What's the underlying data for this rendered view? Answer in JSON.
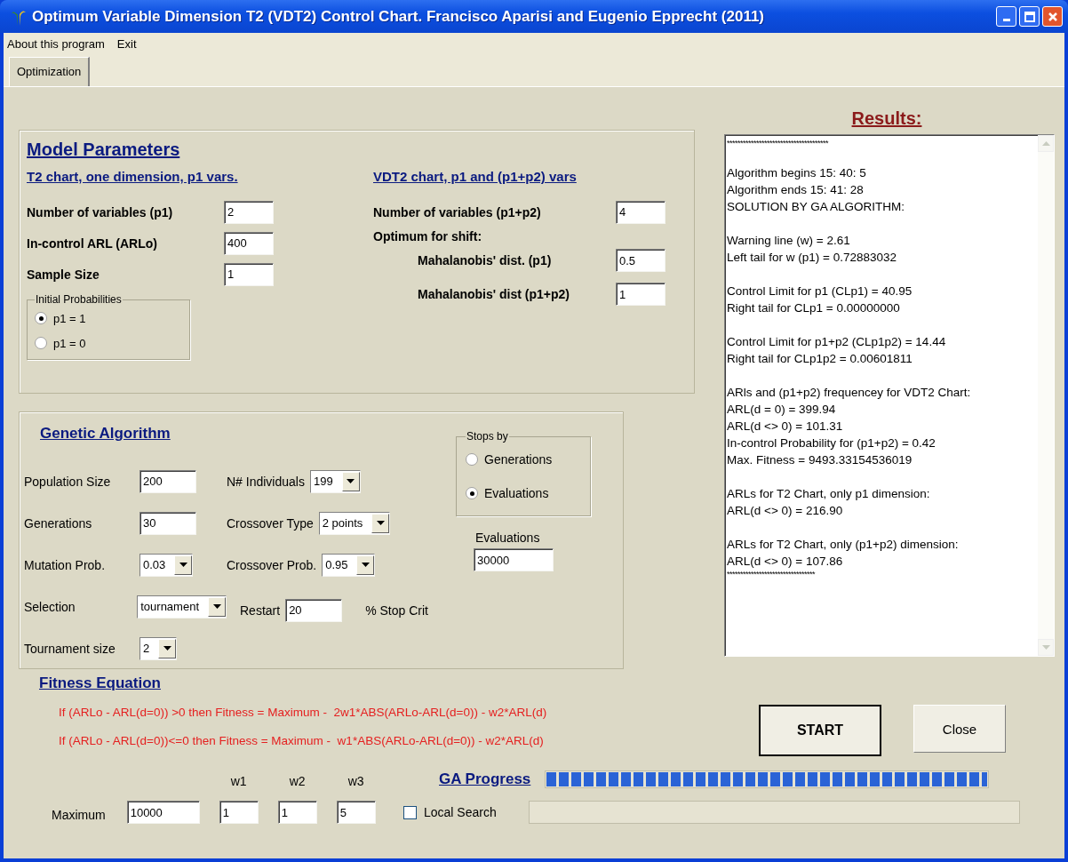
{
  "window": {
    "title": "Optimum Variable Dimension T2 (VDT2) Control Chart. Francisco Aparisi and Eugenio Epprecht (2011)"
  },
  "menu": [
    {
      "label": "About this program"
    },
    {
      "label": "Exit"
    }
  ],
  "tabs": [
    {
      "label": "Optimization",
      "selected": true
    }
  ],
  "model_parameters": {
    "title": "Model Parameters",
    "t2": {
      "heading": "T2 chart, one dimension, p1 vars.",
      "fields": [
        {
          "label": "Number of variables (p1)",
          "value": "2"
        },
        {
          "label": "In-control ARL (ARLo)",
          "value": "400"
        },
        {
          "label": "Sample Size",
          "value": "1"
        }
      ],
      "initial_probabilities": {
        "title": "Initial Probabilities",
        "options": [
          {
            "label": "p1 = 1",
            "selected": true
          },
          {
            "label": "p1 = 0",
            "selected": false
          }
        ]
      }
    },
    "vdt2": {
      "heading": "VDT2 chart, p1 and (p1+p2) vars",
      "fields": [
        {
          "label": "Number of variables (p1+p2)",
          "value": "4"
        }
      ],
      "shift_heading": "Optimum for shift:",
      "shift_fields": [
        {
          "label": "Mahalanobis' dist. (p1)",
          "value": "0.5"
        },
        {
          "label": "Mahalanobis' dist  (p1+p2)",
          "value": "1"
        }
      ]
    }
  },
  "genetic_algorithm": {
    "title": "Genetic Algorithm",
    "column_1": [
      {
        "label": "Population Size",
        "value": "200",
        "kind": "input"
      },
      {
        "label": "Generations",
        "value": "30",
        "kind": "input"
      },
      {
        "label": "Mutation Prob.",
        "value": "0.03",
        "kind": "dropdown"
      },
      {
        "label": "Selection",
        "value": "tournament",
        "kind": "dropdown"
      },
      {
        "label": "Tournament size",
        "value": "2",
        "kind": "dropdown"
      }
    ],
    "column_2": [
      {
        "label": "N# Individuals",
        "value": "199",
        "kind": "dropdown"
      },
      {
        "label": "Crossover Type",
        "value": "2 points",
        "kind": "dropdown"
      },
      {
        "label": "Crossover Prob.",
        "value": "0.95",
        "kind": "dropdown"
      },
      {
        "label": "Restart",
        "value": "20",
        "kind": "input",
        "suffix": "% Stop Crit"
      }
    ],
    "stops_by": {
      "title": "Stops by",
      "options": [
        {
          "label": "Generations",
          "selected": false
        },
        {
          "label": "Evaluations",
          "selected": true
        }
      ]
    },
    "evaluations": {
      "label": "Evaluations",
      "value": "30000"
    }
  },
  "results": {
    "title": "Results:",
    "header_rule": "**************************************",
    "paragraphs": [
      [
        "Algorithm begins 15: 40: 5",
        "Algorithm ends 15: 41: 28",
        "SOLUTION BY GA ALGORITHM:"
      ],
      [
        "Warning line (w) = 2.61",
        "Left tail for w (p1) = 0.72883032"
      ],
      [
        "Control Limit for p1 (CLp1) = 40.95",
        "Right tail for CLp1 = 0.00000000"
      ],
      [
        "Control Limit for p1+p2 (CLp1p2) = 14.44",
        "Right tail for CLp1p2 = 0.00601811"
      ],
      [
        "ARls and (p1+p2) frequencey for VDT2 Chart:",
        "ARL(d = 0) = 399.94",
        "ARL(d <> 0) = 101.31",
        "In-control Probability for (p1+p2) = 0.42",
        "Max. Fitness = 9493.33154536019"
      ],
      [
        "ARLs for T2 Chart, only p1 dimension:",
        "ARL(d <> 0) = 216.90"
      ],
      [
        "ARLs for T2 Chart, only (p1+p2) dimension:",
        "ARL(d <> 0) = 107.86"
      ]
    ],
    "footer_rule": "*********************************"
  },
  "fitness_equation": {
    "title": "Fitness Equation",
    "lines": [
      "If (ARLo - ARL(d=0)) >0 then Fitness = Maximum -  2w1*ABS(ARLo-ARL(d=0)) - w2*ARL(d)",
      "If (ARLo - ARL(d=0))<=0 then Fitness = Maximum -  w1*ABS(ARLo-ARL(d=0)) - w2*ARL(d)"
    ],
    "maximum": {
      "label": "Maximum",
      "value": "10000"
    },
    "weights": [
      {
        "label": "w1",
        "value": "1"
      },
      {
        "label": "w2",
        "value": "1"
      },
      {
        "label": "w3",
        "value": "5"
      }
    ]
  },
  "buttons": [
    {
      "label": "START",
      "default": true
    },
    {
      "label": "Close",
      "default": false
    }
  ],
  "ga_progress": {
    "label": "GA Progress",
    "level": 1
  },
  "local_search": {
    "label": "Local Search",
    "checked": false
  }
}
